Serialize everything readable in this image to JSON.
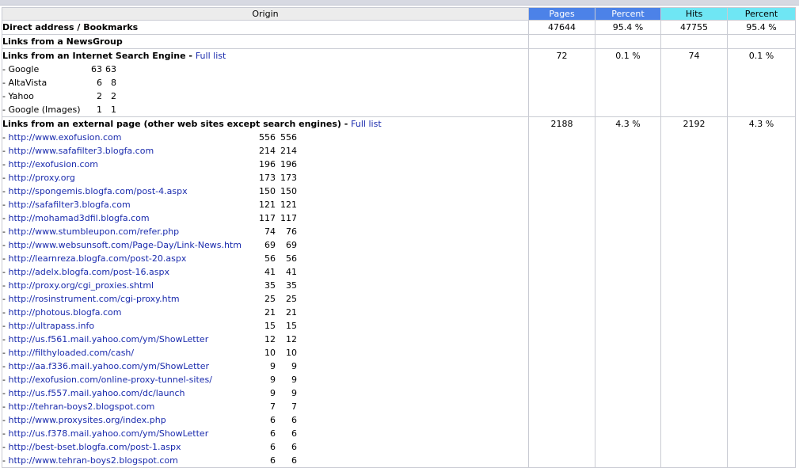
{
  "header": {
    "origin": "Origin",
    "pages": "Pages",
    "percent1": "Percent",
    "hits": "Hits",
    "percent2": "Percent"
  },
  "colors": {
    "pages_header": "#4c82e8",
    "hits_header": "#6fe6f4",
    "link": "#1a2bad"
  },
  "direct": {
    "label": "Direct address / Bookmarks",
    "pages": "47644",
    "pct1": "95.4 %",
    "hits": "47755",
    "pct2": "95.4 %"
  },
  "newsgroup": {
    "label": "Links from a NewsGroup"
  },
  "search_engine": {
    "label": "Links from an Internet Search Engine",
    "full_list": "Full list",
    "pages": "72",
    "pct1": "0.1 %",
    "hits": "74",
    "pct2": "0.1 %",
    "items": [
      {
        "name": "- Google",
        "pages": "63",
        "hits": "63"
      },
      {
        "name": "- AltaVista",
        "pages": "6",
        "hits": "8"
      },
      {
        "name": "- Yahoo",
        "pages": "2",
        "hits": "2"
      },
      {
        "name": "- Google (Images)",
        "pages": "1",
        "hits": "1"
      }
    ]
  },
  "external": {
    "label": "Links from an external page (other web sites except search engines)",
    "full_list": "Full list",
    "pages": "2188",
    "pct1": "4.3 %",
    "hits": "2192",
    "pct2": "4.3 %",
    "items": [
      {
        "url": "http://www.exofusion.com",
        "pages": "556",
        "hits": "556"
      },
      {
        "url": "http://www.safafilter3.blogfa.com",
        "pages": "214",
        "hits": "214"
      },
      {
        "url": "http://exofusion.com",
        "pages": "196",
        "hits": "196"
      },
      {
        "url": "http://proxy.org",
        "pages": "173",
        "hits": "173"
      },
      {
        "url": "http://spongemis.blogfa.com/post-4.aspx",
        "pages": "150",
        "hits": "150"
      },
      {
        "url": "http://safafilter3.blogfa.com",
        "pages": "121",
        "hits": "121"
      },
      {
        "url": "http://mohamad3dfil.blogfa.com",
        "pages": "117",
        "hits": "117"
      },
      {
        "url": "http://www.stumbleupon.com/refer.php",
        "pages": "74",
        "hits": "76"
      },
      {
        "url": "http://www.websunsoft.com/Page-Day/Link-News.htm",
        "pages": "69",
        "hits": "69"
      },
      {
        "url": "http://learnreza.blogfa.com/post-20.aspx",
        "pages": "56",
        "hits": "56"
      },
      {
        "url": "http://adelx.blogfa.com/post-16.aspx",
        "pages": "41",
        "hits": "41"
      },
      {
        "url": "http://proxy.org/cgi_proxies.shtml",
        "pages": "35",
        "hits": "35"
      },
      {
        "url": "http://rosinstrument.com/cgi-proxy.htm",
        "pages": "25",
        "hits": "25"
      },
      {
        "url": "http://photous.blogfa.com",
        "pages": "21",
        "hits": "21"
      },
      {
        "url": "http://ultrapass.info",
        "pages": "15",
        "hits": "15"
      },
      {
        "url": "http://us.f561.mail.yahoo.com/ym/ShowLetter",
        "pages": "12",
        "hits": "12"
      },
      {
        "url": "http://filthyloaded.com/cash/",
        "pages": "10",
        "hits": "10"
      },
      {
        "url": "http://aa.f336.mail.yahoo.com/ym/ShowLetter",
        "pages": "9",
        "hits": "9"
      },
      {
        "url": "http://exofusion.com/online-proxy-tunnel-sites/",
        "pages": "9",
        "hits": "9"
      },
      {
        "url": "http://us.f557.mail.yahoo.com/dc/launch",
        "pages": "9",
        "hits": "9"
      },
      {
        "url": "http://tehran-boys2.blogspot.com",
        "pages": "7",
        "hits": "7"
      },
      {
        "url": "http://www.proxysites.org/index.php",
        "pages": "6",
        "hits": "6"
      },
      {
        "url": "http://us.f378.mail.yahoo.com/ym/ShowLetter",
        "pages": "6",
        "hits": "6"
      },
      {
        "url": "http://best-bset.blogfa.com/post-1.aspx",
        "pages": "6",
        "hits": "6"
      },
      {
        "url": "http://www.tehran-boys2.blogspot.com",
        "pages": "6",
        "hits": "6"
      }
    ]
  }
}
